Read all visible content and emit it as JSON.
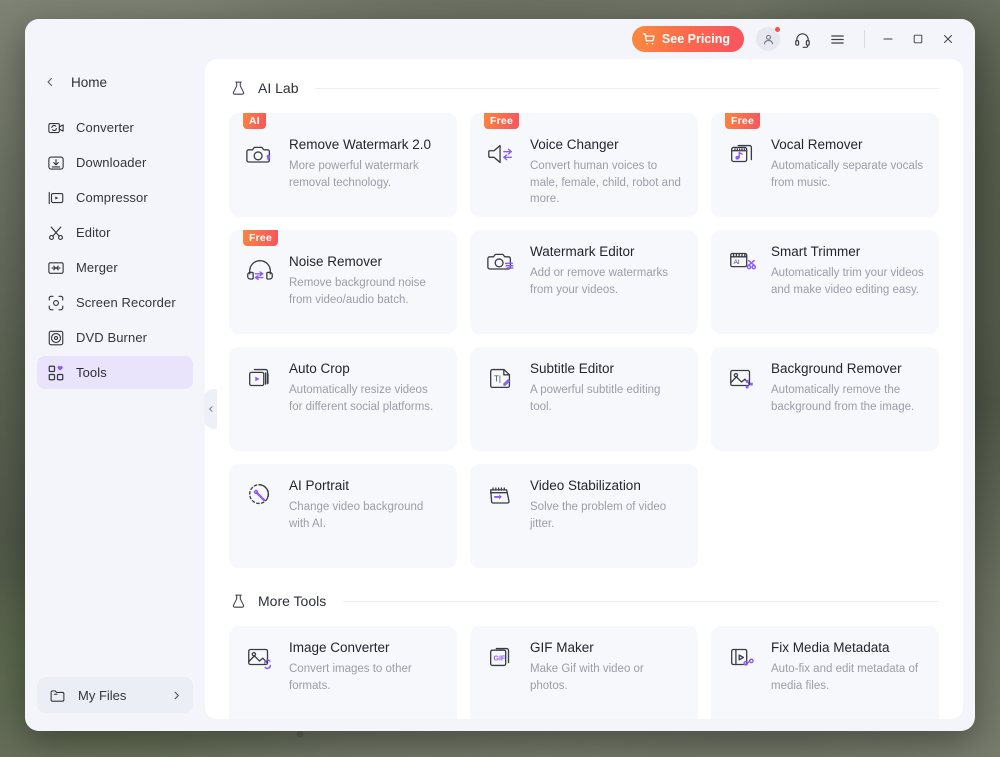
{
  "titlebar": {
    "pricing_label": "See Pricing",
    "cart_icon": "shopping-cart-icon",
    "avatar_icon": "user-avatar-icon",
    "support_icon": "headset-icon",
    "menu_icon": "hamburger-menu-icon",
    "minimize_icon": "minimize-icon",
    "maximize_icon": "maximize-icon",
    "close_icon": "close-icon"
  },
  "sidebar": {
    "home_label": "Home",
    "back_icon": "chevron-left-icon",
    "collapse_icon": "chevron-left-icon",
    "items": [
      {
        "label": "Converter",
        "icon": "converter-icon",
        "active": false
      },
      {
        "label": "Downloader",
        "icon": "download-icon",
        "active": false
      },
      {
        "label": "Compressor",
        "icon": "compressor-icon",
        "active": false
      },
      {
        "label": "Editor",
        "icon": "scissors-icon",
        "active": false
      },
      {
        "label": "Merger",
        "icon": "merger-icon",
        "active": false
      },
      {
        "label": "Screen Recorder",
        "icon": "screen-record-icon",
        "active": false
      },
      {
        "label": "DVD Burner",
        "icon": "disc-icon",
        "active": false
      },
      {
        "label": "Tools",
        "icon": "tools-grid-icon",
        "active": true
      }
    ],
    "my_files": {
      "label": "My Files",
      "icon": "folder-icon",
      "chevron": "chevron-right-icon"
    }
  },
  "sections": [
    {
      "title": "AI Lab",
      "icon": "lab-flask-icon",
      "cards": [
        {
          "title": "Remove Watermark 2.0",
          "desc": "More powerful watermark removal technology.",
          "badge": "AI",
          "icon": "camera-watermark-icon"
        },
        {
          "title": "Voice Changer",
          "desc": "Convert human voices to male, female, child, robot and more.",
          "badge": "Free",
          "icon": "speaker-voice-icon"
        },
        {
          "title": "Vocal Remover",
          "desc": "Automatically separate vocals from music.",
          "badge": "Free",
          "icon": "music-note-icon"
        },
        {
          "title": "Noise Remover",
          "desc": "Remove background noise from video/audio batch.",
          "badge": "Free",
          "icon": "headphone-noise-icon"
        },
        {
          "title": "Watermark Editor",
          "desc": "Add or remove watermarks from your videos.",
          "badge": "",
          "icon": "camera-edit-icon"
        },
        {
          "title": "Smart Trimmer",
          "desc": "Automatically trim your videos and make video editing easy.",
          "badge": "",
          "icon": "ai-trim-icon"
        },
        {
          "title": "Auto Crop",
          "desc": "Automatically resize videos for different social platforms.",
          "badge": "",
          "icon": "auto-crop-icon"
        },
        {
          "title": "Subtitle Editor",
          "desc": "A powerful subtitle editing tool.",
          "badge": "",
          "icon": "subtitle-icon"
        },
        {
          "title": "Background Remover",
          "desc": "Automatically remove the background from the image.",
          "badge": "",
          "icon": "image-background-icon"
        },
        {
          "title": "AI Portrait",
          "desc": "Change video background with AI.",
          "badge": "",
          "icon": "portrait-wand-icon"
        },
        {
          "title": "Video Stabilization",
          "desc": "Solve the problem of video jitter.",
          "badge": "",
          "icon": "stabilize-icon"
        }
      ]
    },
    {
      "title": "More Tools",
      "icon": "lab-flask-icon",
      "cards": [
        {
          "title": "Image Converter",
          "desc": "Convert images to other formats.",
          "badge": "",
          "icon": "image-convert-icon"
        },
        {
          "title": "GIF Maker",
          "desc": "Make Gif with video or photos.",
          "badge": "",
          "icon": "gif-icon"
        },
        {
          "title": "Fix Media Metadata",
          "desc": "Auto-fix and edit metadata of media files.",
          "badge": "",
          "icon": "metadata-icon"
        }
      ]
    }
  ],
  "colors": {
    "accent_purple": "#8b5cf6",
    "badge_gradient_start": "#fb8440",
    "badge_gradient_end": "#f9545d",
    "active_nav_bg": "#e9e3fb",
    "card_bg": "#f7f8fc",
    "window_bg": "#f4f5fa"
  }
}
